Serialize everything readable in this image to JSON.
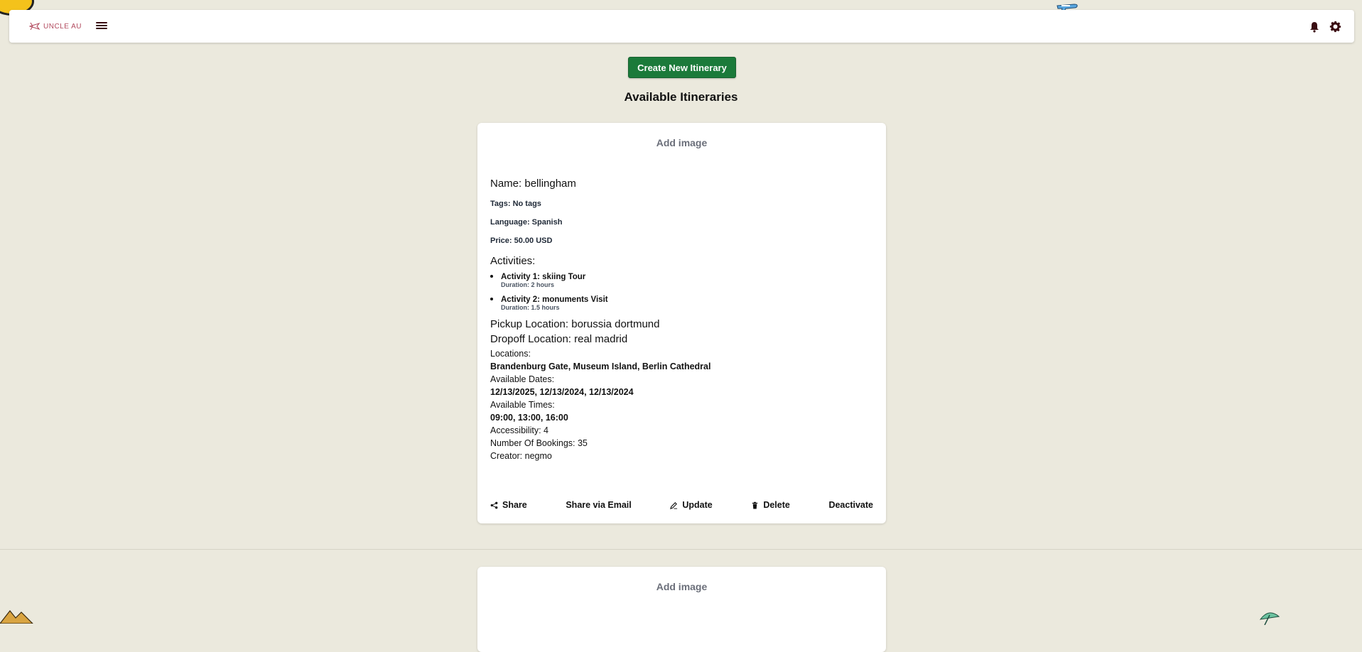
{
  "header": {
    "logo_text": "UNCLE AU",
    "menu_icon": "hamburger-icon",
    "notification_icon": "bell-icon",
    "settings_icon": "gear-icon"
  },
  "main": {
    "create_button_label": "Create New Itinerary",
    "section_title": "Available Itineraries"
  },
  "itineraries": [
    {
      "add_image_label": "Add image",
      "name": "Name: bellingham",
      "tags": "Tags: No tags",
      "language": "Language: Spanish",
      "price": "Price: 50.00 USD",
      "activities_label": "Activities:",
      "activities": [
        {
          "name": "Activity 1: skiing Tour",
          "duration": "Duration: 2 hours"
        },
        {
          "name": "Activity 2: monuments Visit",
          "duration": "Duration: 1.5 hours"
        }
      ],
      "pickup": "Pickup Location: borussia dortmund",
      "dropoff": "Dropoff Location: real madrid",
      "locations_label": "Locations:",
      "locations": "Brandenburg Gate, Museum Island, Berlin Cathedral",
      "dates_label": "Available Dates:",
      "dates": "12/13/2025, 12/13/2024, 12/13/2024",
      "times_label": "Available Times:",
      "times": "09:00, 13:00, 16:00",
      "accessibility": "Accessibility: 4",
      "bookings": "Number Of Bookings: 35",
      "creator": "Creator: negmo",
      "actions": {
        "share": "Share",
        "share_email": "Share via Email",
        "update": "Update",
        "delete": "Delete",
        "deactivate": "Deactivate"
      }
    },
    {
      "add_image_label": "Add image"
    }
  ],
  "colors": {
    "background": "#ebe9dd",
    "primary_button": "#1b7a3a",
    "icon_dark": "#3a0d12",
    "logo_accent": "#b24a5e"
  }
}
